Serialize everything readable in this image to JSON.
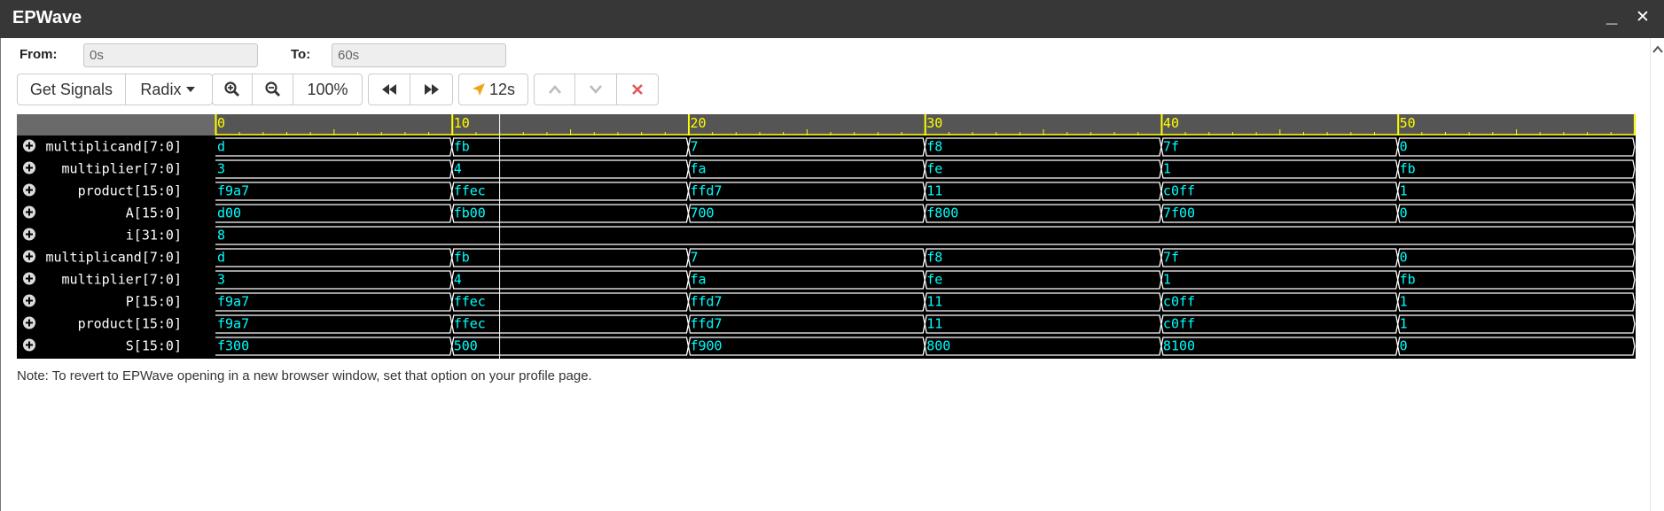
{
  "window": {
    "title": "EPWave",
    "minimize_label": "_",
    "close_label": "✕"
  },
  "range": {
    "from_label": "From:",
    "from_value": "0s",
    "to_label": "To:",
    "to_value": "60s"
  },
  "toolbar": {
    "get_signals": "Get Signals",
    "radix": "Radix",
    "zoom_level": "100%",
    "cursor_time": "12s",
    "icons": [
      "zoom-in-icon",
      "zoom-out-icon",
      "rewind-icon",
      "fast-forward-icon",
      "cursor-icon",
      "arrow-up-icon",
      "arrow-down-icon",
      "close-icon"
    ]
  },
  "timeline": {
    "start": 0,
    "end": 60,
    "major_labels": [
      "0",
      "10",
      "20",
      "30",
      "40",
      "50"
    ],
    "cursor_time": 12
  },
  "signals": [
    {
      "name": "multiplicand[7:0]",
      "values": [
        "d",
        "fb",
        "7",
        "f8",
        "7f",
        "0"
      ]
    },
    {
      "name": "multiplier[7:0]",
      "values": [
        "3",
        "4",
        "fa",
        "fe",
        "1",
        "fb"
      ]
    },
    {
      "name": "product[15:0]",
      "values": [
        "f9a7",
        "ffec",
        "ffd7",
        "11",
        "c0ff",
        "1"
      ]
    },
    {
      "name": "A[15:0]",
      "values": [
        "d00",
        "fb00",
        "700",
        "f800",
        "7f00",
        "0"
      ]
    },
    {
      "name": "i[31:0]",
      "values": [
        "8"
      ]
    },
    {
      "name": "multiplicand[7:0]",
      "values": [
        "d",
        "fb",
        "7",
        "f8",
        "7f",
        "0"
      ]
    },
    {
      "name": "multiplier[7:0]",
      "values": [
        "3",
        "4",
        "fa",
        "fe",
        "1",
        "fb"
      ]
    },
    {
      "name": "P[15:0]",
      "values": [
        "f9a7",
        "ffec",
        "ffd7",
        "11",
        "c0ff",
        "1"
      ]
    },
    {
      "name": "product[15:0]",
      "values": [
        "f9a7",
        "ffec",
        "ffd7",
        "11",
        "c0ff",
        "1"
      ]
    },
    {
      "name": "S[15:0]",
      "values": [
        "f300",
        "500",
        "f900",
        "800",
        "8100",
        "0"
      ]
    }
  ],
  "note": "Note: To revert to EPWave opening in a new browser window, set that option on your profile page.",
  "colors": {
    "value_text": "#00ffff",
    "wave_line": "#ffffff",
    "ruler_line": "#ffff00",
    "ruler_bg": "#555555",
    "cursor": "#ffffff"
  }
}
